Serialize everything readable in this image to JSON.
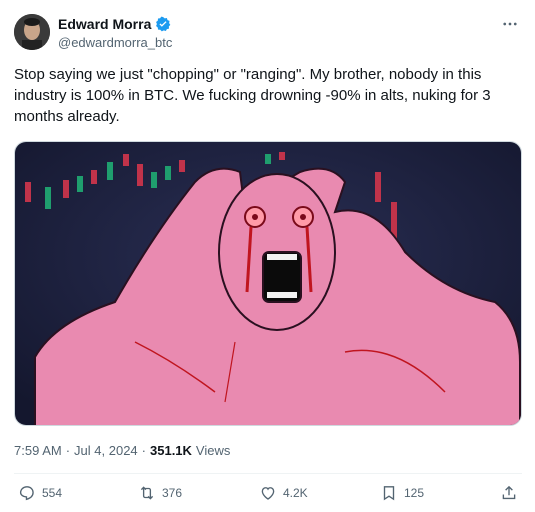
{
  "author": {
    "name": "Edward Morra",
    "handle": "@edwardmorra_btc",
    "verified_icon": "verified-badge-icon"
  },
  "tweet": {
    "text": "Stop saying we just \"chopping\" or \"ranging\". My brother, nobody in this industry is 100% in BTC. We fucking drowning -90% in alts, nuking for 3 months already.",
    "media_icon": "screaming-wojak-meme-image"
  },
  "meta": {
    "time": "7:59 AM",
    "sep1": "·",
    "date": "Jul 4, 2024",
    "sep2": "·",
    "views_count": "351.1K",
    "views_label": "Views"
  },
  "actions": {
    "replies": "554",
    "reposts": "376",
    "likes": "4.2K",
    "bookmarks": "125"
  },
  "colors": {
    "verified": "#1d9bf0",
    "secondary_text": "#536471",
    "media_bg": "#1b1f3b",
    "figure_pink": "#e98ab0",
    "candle_green": "#1f9e6e",
    "candle_red": "#c0334a"
  }
}
